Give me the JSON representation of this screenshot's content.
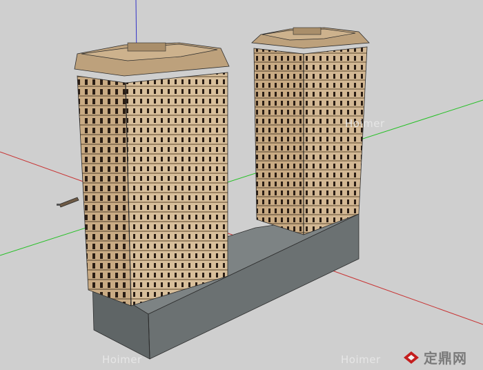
{
  "scene": {
    "background_color": "#cfcfcf",
    "axis_colors": {
      "red": "#c83232",
      "green": "#23c023",
      "blue": "#3232c8"
    },
    "building_colors": {
      "facade": "#c9ab84",
      "facade_light": "#d8bf9b",
      "shadow": "#8e7658",
      "window": "#2a1d14",
      "roof": "#bda17c"
    },
    "base_colors": {
      "front": "#6b7172",
      "top": "#7d8384",
      "side": "#5f6566"
    }
  },
  "watermarks": {
    "upper": "Hoimer",
    "lower_left": "Hoimer",
    "lower_right": "Hoimer"
  },
  "logo": {
    "text": "定鼎网",
    "icon": "diamond-logo-icon",
    "color": "#c41e1e"
  }
}
